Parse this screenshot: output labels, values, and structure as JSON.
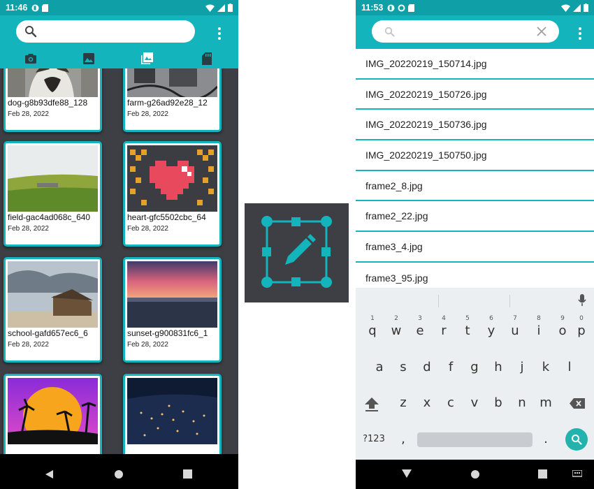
{
  "left_phone": {
    "status": {
      "time": "11:46"
    },
    "search": {
      "placeholder": ""
    },
    "tabs": [
      "camera-icon",
      "image-icon",
      "gallery-icon",
      "sd-card-icon"
    ],
    "cards": [
      {
        "name": "dog-g8b93dfe88_128",
        "date": "Feb 28, 2022"
      },
      {
        "name": "farm-g26ad92e28_12",
        "date": "Feb 28, 2022"
      },
      {
        "name": "field-gac4ad068c_640",
        "date": "Feb 28, 2022"
      },
      {
        "name": "heart-gfc5502cbc_64",
        "date": "Feb 28, 2022"
      },
      {
        "name": "school-gafd657ec6_6",
        "date": "Feb 28, 2022"
      },
      {
        "name": "sunset-g900831fc6_1",
        "date": "Feb 28, 2022"
      },
      {
        "name": "",
        "date": ""
      },
      {
        "name": "",
        "date": ""
      }
    ]
  },
  "right_phone": {
    "status": {
      "time": "11:53"
    },
    "search": {
      "value": ""
    },
    "files": [
      "IMG_20220219_150714.jpg",
      "IMG_20220219_150726.jpg",
      "IMG_20220219_150736.jpg",
      "IMG_20220219_150750.jpg",
      "frame2_8.jpg",
      "frame2_22.jpg",
      "frame3_4.jpg",
      "frame3_95.jpg"
    ],
    "keyboard": {
      "row1": [
        "q",
        "w",
        "e",
        "r",
        "t",
        "y",
        "u",
        "i",
        "o",
        "p"
      ],
      "row1_hints": [
        "1",
        "2",
        "3",
        "4",
        "5",
        "6",
        "7",
        "8",
        "9",
        "0"
      ],
      "row2": [
        "a",
        "s",
        "d",
        "f",
        "g",
        "h",
        "j",
        "k",
        "l"
      ],
      "row3": [
        "z",
        "x",
        "c",
        "v",
        "b",
        "n",
        "m"
      ],
      "symbols": "?123",
      "comma": ",",
      "period": "."
    }
  },
  "colors": {
    "accent": "#14b4bd",
    "dark_bg": "#3d3f44"
  }
}
